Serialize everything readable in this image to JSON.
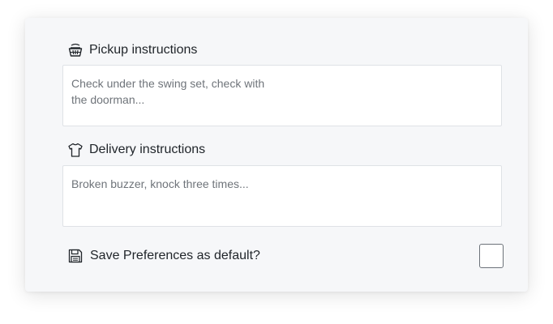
{
  "pickup": {
    "label": "Pickup instructions",
    "icon": "basket-icon",
    "placeholder": "Check under the swing set, check with the doorman..."
  },
  "delivery": {
    "label": "Delivery instructions",
    "icon": "shirt-icon",
    "placeholder": "Broken buzzer, knock three times..."
  },
  "preferences": {
    "label": "Save Preferences as default?",
    "icon": "floppy-disk-icon",
    "checked": false
  }
}
